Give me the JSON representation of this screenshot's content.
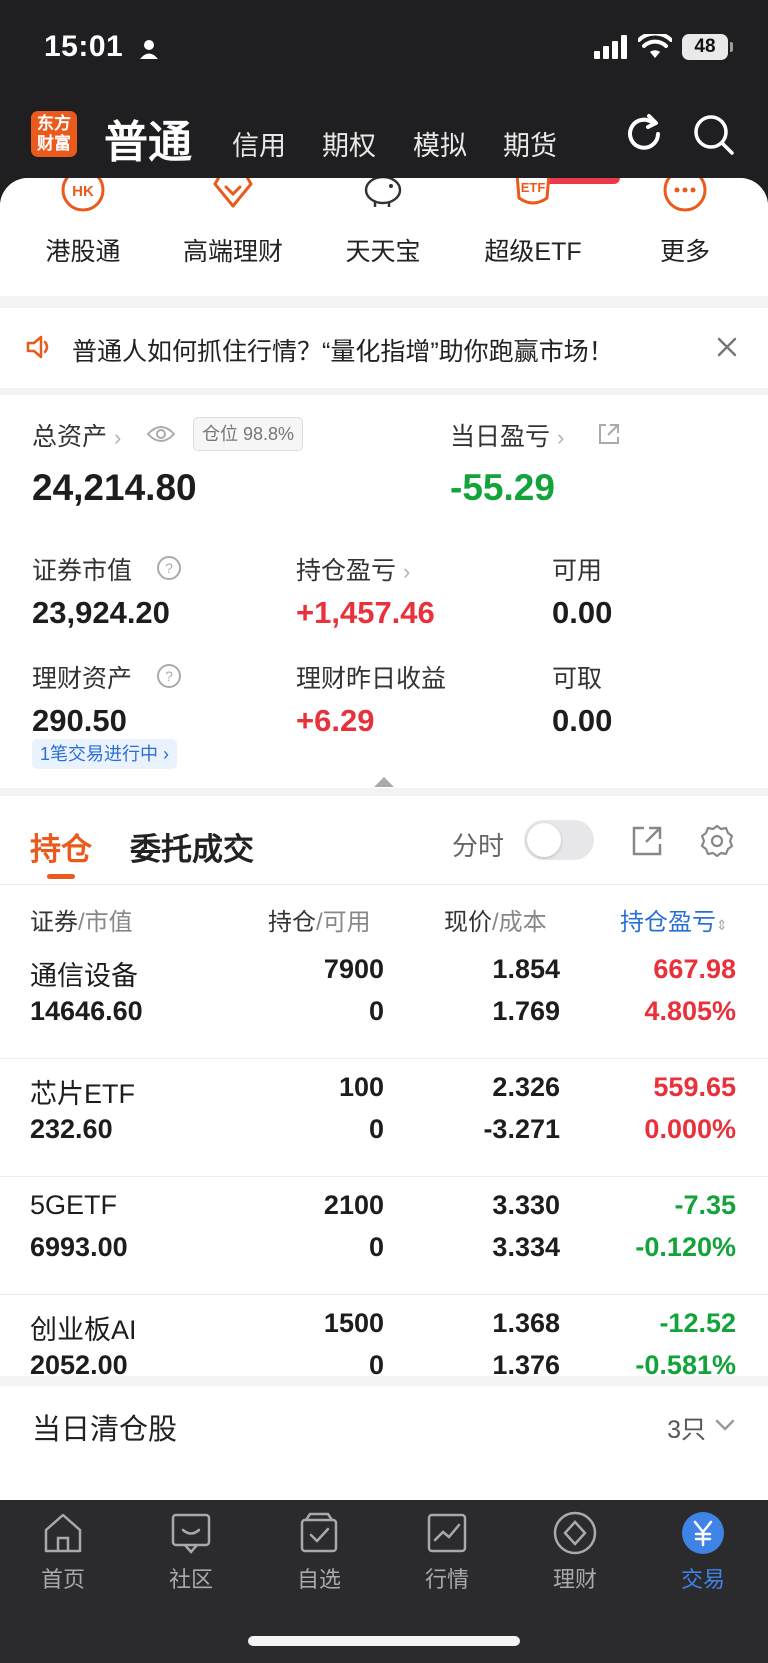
{
  "status": {
    "time": "15:01",
    "battery": "48"
  },
  "topnav": {
    "logo": "东方财富",
    "main": "普通",
    "tabs": [
      "信用",
      "期权",
      "模拟",
      "期货"
    ]
  },
  "quick": [
    {
      "icon": "hk-icon",
      "label": "港股通"
    },
    {
      "icon": "diamond-icon",
      "label": "高端理财"
    },
    {
      "icon": "piggy-bank-icon",
      "label": "天天宝"
    },
    {
      "icon": "etf-icon",
      "label": "超级ETF"
    },
    {
      "icon": "more-dots-icon",
      "label": "更多"
    }
  ],
  "quick_badge": {
    "hk": "HK",
    "etf": "ETF"
  },
  "notice": {
    "text": "普通人如何抓住行情？“量化指增”助你跑赢市场！"
  },
  "assets": {
    "total_label": "总资产",
    "position_badge": "仓位 98.8%",
    "total_value": "24,214.80",
    "daily_pl_label": "当日盈亏",
    "daily_pl_value": "-55.29",
    "securities_label": "证券市值",
    "securities_value": "23,924.20",
    "holding_pl_label": "持仓盈亏",
    "holding_pl_value": "+1,457.46",
    "available_label": "可用",
    "available_value": "0.00",
    "wealth_label": "理财资产",
    "wealth_value": "290.50",
    "wealth_yesterday_label": "理财昨日收益",
    "wealth_yesterday_value": "+6.29",
    "withdrawable_label": "可取",
    "withdrawable_value": "0.00",
    "pending_badge": "1笔交易进行中 ›"
  },
  "holdings": {
    "tab_active": "持仓",
    "tab_other": "委托成交",
    "fenshi_label": "分时",
    "headers": {
      "c1a": "证券",
      "c1b": "/市值",
      "c2a": "持仓",
      "c2b": "/可用",
      "c3a": "现价",
      "c3b": "/成本",
      "c4": "持仓盈亏"
    },
    "rows": [
      {
        "name": "通信设备",
        "market_value": "14646.60",
        "qty": "7900",
        "avail": "0",
        "price": "1.854",
        "cost": "1.769",
        "pl": "667.98",
        "pl_pct": "4.805%",
        "color": "red"
      },
      {
        "name": "芯片ETF",
        "market_value": "232.60",
        "qty": "100",
        "avail": "0",
        "price": "2.326",
        "cost": "-3.271",
        "pl": "559.65",
        "pl_pct": "0.000%",
        "color": "red"
      },
      {
        "name": "5GETF",
        "market_value": "6993.00",
        "qty": "2100",
        "avail": "0",
        "price": "3.330",
        "cost": "3.334",
        "pl": "-7.35",
        "pl_pct": "-0.120%",
        "color": "green"
      },
      {
        "name": "创业板AI",
        "market_value": "2052.00",
        "qty": "1500",
        "avail": "0",
        "price": "1.368",
        "cost": "1.376",
        "pl": "-12.52",
        "pl_pct": "-0.581%",
        "color": "green"
      }
    ]
  },
  "cleared": {
    "label": "当日清仓股",
    "count": "3只"
  },
  "tabbar": [
    {
      "label": "首页",
      "icon": "home-icon"
    },
    {
      "label": "社区",
      "icon": "community-icon"
    },
    {
      "label": "自选",
      "icon": "watchlist-icon"
    },
    {
      "label": "行情",
      "icon": "market-chart-icon"
    },
    {
      "label": "理财",
      "icon": "wealth-diamond-icon"
    },
    {
      "label": "交易",
      "icon": "trade-yuan-icon"
    }
  ],
  "colors": {
    "accent": "#ea5a1c",
    "up": "#e8313a",
    "down": "#12a43a",
    "link": "#2a6fd6"
  }
}
